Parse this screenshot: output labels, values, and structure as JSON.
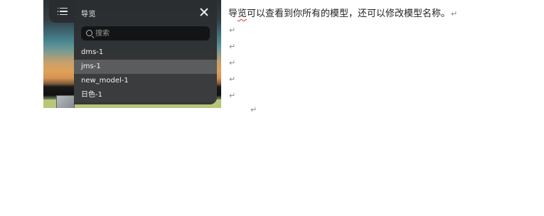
{
  "navigator": {
    "menu_icon": "hamburger-icon",
    "title": "导览",
    "close_icon": "close-icon",
    "search_icon": "search-icon",
    "search_placeholder": "搜索",
    "search_value": "",
    "items": [
      {
        "label": "dms-1",
        "state": "normal"
      },
      {
        "label": "jms-1",
        "state": "selected"
      },
      {
        "label": "new_model-1",
        "state": "hover"
      },
      {
        "label": "日色-1",
        "state": "hover"
      }
    ]
  },
  "document": {
    "text_before_squiggle": "导",
    "squiggle_word": "览",
    "text_after_squiggle": "可以查看到你所有的模型，还可以修改模型名称。",
    "paragraph_mark": "↵",
    "spellcheck_color": "#d23a2e"
  }
}
